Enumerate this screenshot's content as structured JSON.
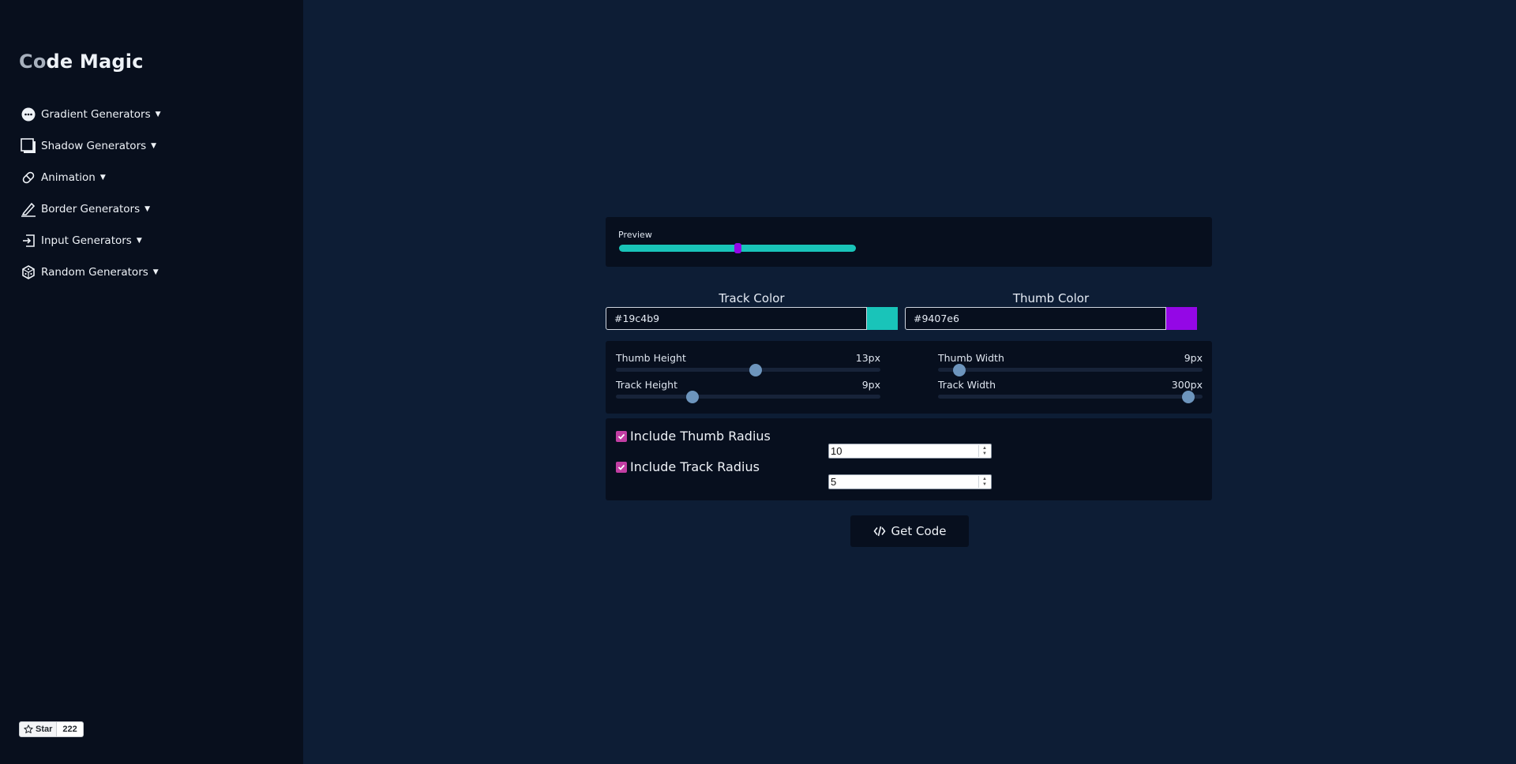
{
  "sidebar": {
    "logo_a": "Co",
    "logo_b": "de Magic",
    "items": [
      {
        "label": "Gradient Generators",
        "icon": "gradient-icon"
      },
      {
        "label": "Shadow Generators",
        "icon": "shadow-icon"
      },
      {
        "label": "Animation",
        "icon": "animation-icon"
      },
      {
        "label": "Border Generators",
        "icon": "border-icon"
      },
      {
        "label": "Input Generators",
        "icon": "input-icon"
      },
      {
        "label": "Random Generators",
        "icon": "dice-icon"
      }
    ],
    "github": {
      "label": "Star",
      "count": "222"
    }
  },
  "preview": {
    "label": "Preview",
    "thumb_position_pct": 50
  },
  "colors": {
    "track": {
      "title": "Track Color",
      "value": "#19c4b9"
    },
    "thumb": {
      "title": "Thumb Color",
      "value": "#9407e6"
    }
  },
  "sliders": {
    "thumb_height": {
      "label": "Thumb Height",
      "value": "13px",
      "fraction": 0.53
    },
    "thumb_width": {
      "label": "Thumb Width",
      "value": "9px",
      "fraction": 0.06
    },
    "track_height": {
      "label": "Track Height",
      "value": "9px",
      "fraction": 0.28
    },
    "track_width": {
      "label": "Track Width",
      "value": "300px",
      "fraction": 0.97
    }
  },
  "radius": {
    "thumb": {
      "label": "Include Thumb Radius",
      "checked": true,
      "value": "10"
    },
    "track": {
      "label": "Include Track Radius",
      "checked": true,
      "value": "5"
    }
  },
  "actions": {
    "get_code": "Get Code"
  },
  "theme": {
    "background": "#0d1d35",
    "sidebar": "#080f1d",
    "panel": "#070f1e",
    "checkbox": "#c23ea3",
    "slider_knob": "#6d95bd"
  }
}
